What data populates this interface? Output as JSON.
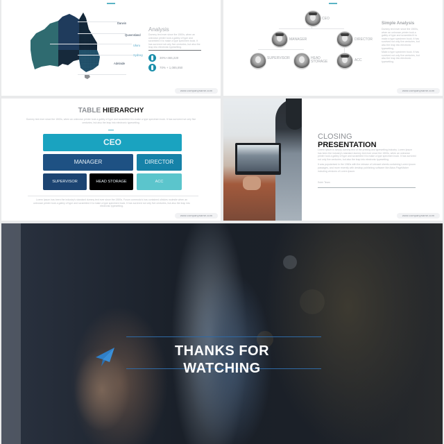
{
  "footer_text": "www.companyname.com",
  "slide_map": {
    "labels": [
      "Darwin",
      "Queensland",
      "Uluru",
      "Sydney",
      "Adelaide"
    ],
    "analysis_title": "Analysis",
    "analysis_text": "Dummy text ever since the 1500s, when an unknown printer took a galley of type and scrambled it to make a type specimen book. It has survived not only five centuries, but also the leap into electronic typesetting.",
    "stats": [
      {
        "value": "30%+465,220"
      },
      {
        "value": "70% + 1,085,850"
      }
    ],
    "colors": {
      "west": "#2e6b70",
      "north": "#1f3b5c",
      "east": "#0f1e2e",
      "southeast": "#1f4f66",
      "accent": "#1b8fab"
    }
  },
  "slide_org": {
    "people": [
      {
        "label": "CEO"
      },
      {
        "label": "MANAGER"
      },
      {
        "label": "DIRECTOR"
      },
      {
        "label": "SUPERVISOR"
      },
      {
        "label": "HEAD STORAGE"
      },
      {
        "label": "ACC"
      }
    ],
    "analysis_title": "Simple Analysis",
    "analysis_text_1": "Dummy text ever since the 1500s, when an unknown printer took a galley of type and scrambled it to make a type specimen book. It has survived not only five centuries, but also the leap into electronic typesetting.",
    "analysis_text_2": "Make a type specimen book. It has survived not only five centuries, but also the leap into electronic typesetting."
  },
  "slide_table": {
    "title_light": "TABLE",
    "title_bold": "HIERARCHY",
    "description": "Dummy text ever since the 1500s, when an unknown printer took a galley of type and scrambled it to make a type specimen book. It has survived not only five centuries, but also the leap into electronic typesetting.",
    "boxes": {
      "ceo": "CEO",
      "manager": "MANAGER",
      "director": "DIRECTOR",
      "supervisor": "SUPERVISOR",
      "head_storage": "HEAD STORAGE",
      "acc": "ACC"
    },
    "colors": {
      "ceo": "#1aa3c0",
      "manager": "#1e5183",
      "director": "#1682a8",
      "supervisor": "#1c4472",
      "head_storage": "#000000",
      "acc": "#5bc5cc"
    },
    "footer_text": "Lorem Ipsum has been the industry's standard dummy text ever since the 1500s. Fusce commodo's has contained ultricies molestie when an unknown printer took a galley of type and scrambled it to make a type specimen book. It has survived not only five centuries, but also the leap into electronic typesetting."
  },
  "slide_closing": {
    "title_light": "CLOSING",
    "title_bold": "PRESENTATION",
    "text_1": "Lorem Ipsum is simply dummy text of the printing and typesetting industry. Lorem Ipsum has been the industry's standard dummy text ever since the 1500s, when an unknown printer took a galley of type and scrambled it to make a type specimen book. It has survived not only five centuries, but also the leap into electronic typesetting.",
    "text_2": "It was popularised in the 1960s with the release of Letraset sheets containing Lorem Ipsum passages, and more recently with desktop publishing software like Aldus PageMaker including versions of Lorem Ipsum.",
    "signature": "Subir Team"
  },
  "slide_thanks": {
    "line1": "THANKS FOR",
    "line2": "WATCHING",
    "accent": "#2f7fc8"
  }
}
